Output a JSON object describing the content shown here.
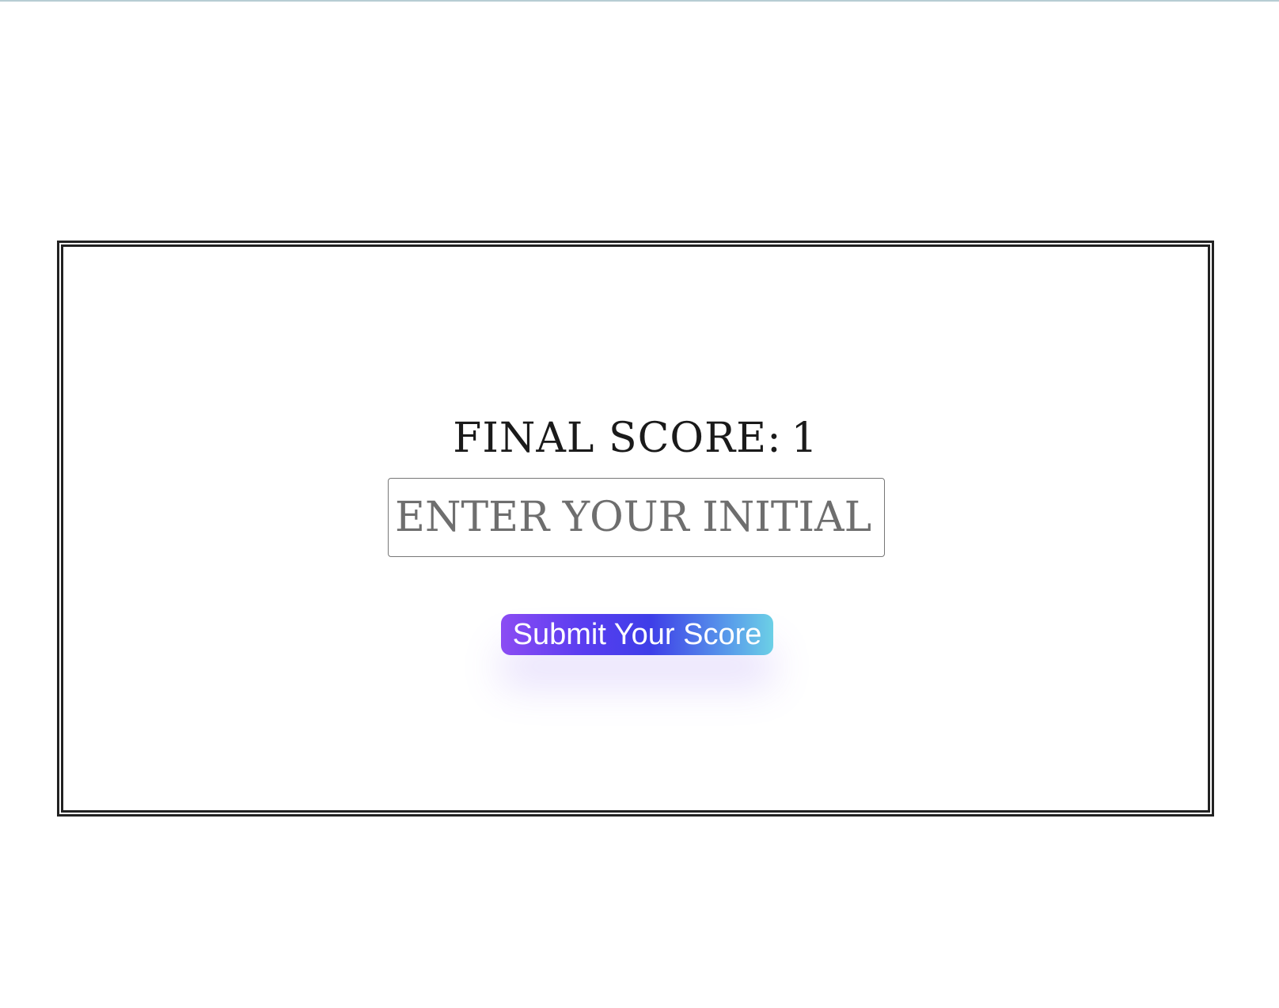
{
  "result_card": {
    "final_score_label": "FINAL SCORE:",
    "final_score_value": "1",
    "initials_input": {
      "value": "",
      "placeholder": "ENTER YOUR INITIAL"
    },
    "submit_button_label": "Submit Your Score",
    "button_gradient_colors": [
      "#8b4cf3",
      "#3e3ee8",
      "#6cd0e6"
    ]
  }
}
